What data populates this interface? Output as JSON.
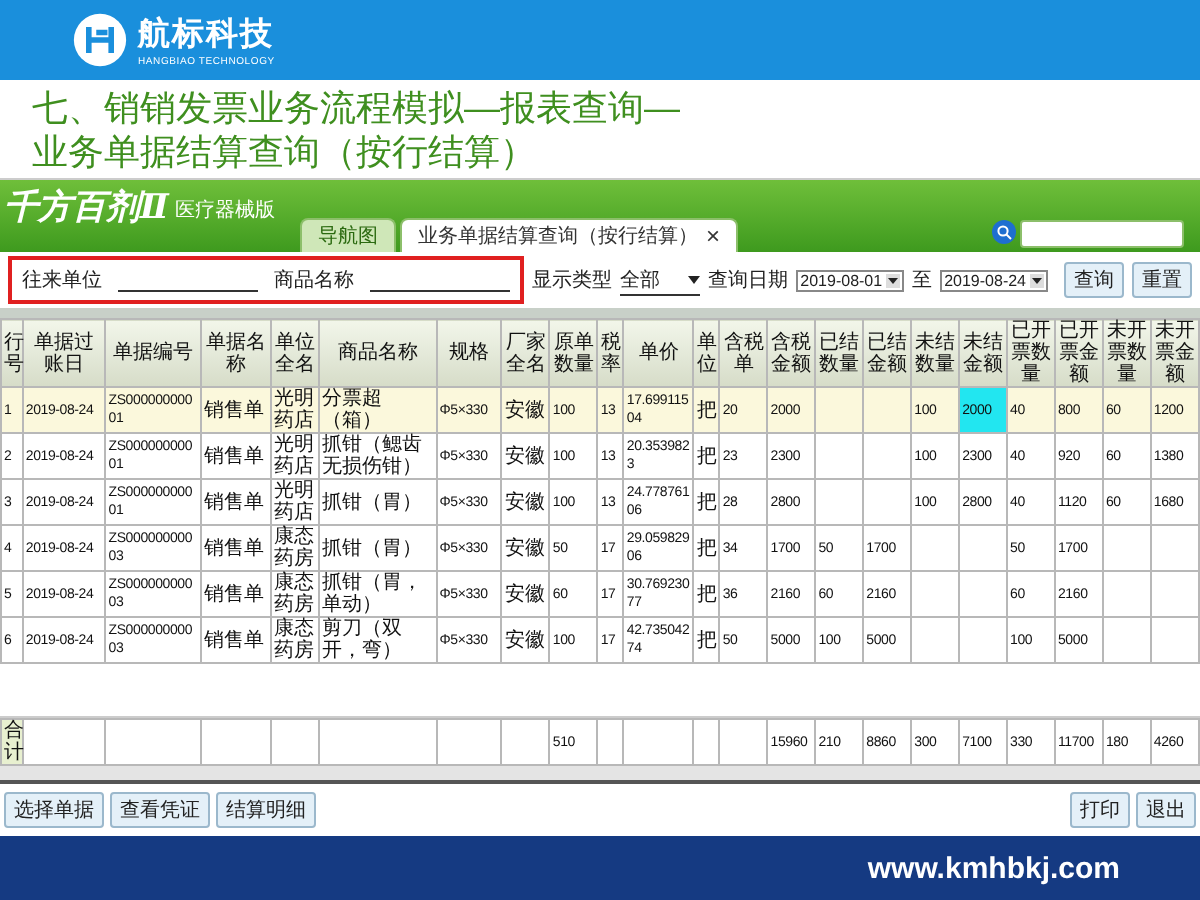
{
  "slide_header": {
    "logo_text": "航标科技",
    "logo_subtitle": "HANGBIAO TECHNOLOGY"
  },
  "title_lines": [
    "七、销销发票业务流程模拟—报表查询—",
    "业务单据结算查询（按行结算）"
  ],
  "app": {
    "brand": "千方百剂Ⅱ",
    "edition": "医疗器械版",
    "tabs": [
      {
        "label": "导航图",
        "selected": false,
        "closable": false
      },
      {
        "label": "业务单据结算查询（按行结算）",
        "selected": true,
        "closable": true
      }
    ],
    "close_glyph": "×",
    "filters": {
      "partner_label": "往来单位",
      "product_label": "商品名称",
      "display_type_label": "显示类型",
      "display_type_value": "全部",
      "date_label": "查询日期",
      "date_from": "2019-08-01",
      "date_to_label": "至",
      "date_to": "2019-08-24",
      "query_button": "查询",
      "reset_button": "重置"
    },
    "table": {
      "columns": [
        "行号",
        "单据过账日",
        "单据编号",
        "单据名称",
        "单位全名",
        "商品名称",
        "规格",
        "厂家全名",
        "原单数量",
        "税率",
        "单价",
        "单位",
        "含税单",
        "含税金额",
        "已结数量",
        "已结金额",
        "未结数量",
        "未结金额",
        "已开票数量",
        "已开票金额",
        "未开票数量",
        "未开票金额"
      ],
      "rows": [
        {
          "selected": true,
          "no": "1",
          "date": "2019-08-24",
          "doc_no": "ZS00000000001",
          "doc_name": "销售单",
          "unit_name": "光明药店",
          "product": "分票超（箱）",
          "spec": "Φ5×330",
          "maker": "安徽",
          "orig_qty": "100",
          "tax_rate": "13",
          "price": "17.69911504",
          "uom": "把",
          "price_incl_tax": "20",
          "amount_incl_tax": "2000",
          "unsettled_qty": "100",
          "unsettled_amt": {
            "text": "2000",
            "selected": true
          },
          "invoiced_qty": "40",
          "invoiced_amt": "800",
          "uninvoiced_qty": "60",
          "uninvoiced_amt": "1200"
        },
        {
          "selected": false,
          "no": "2",
          "date": "2019-08-24",
          "doc_no": "ZS00000000001",
          "doc_name": "销售单",
          "unit_name": "光明药店",
          "product": "抓钳（鳃齿无损伤钳）",
          "spec": "Φ5×330",
          "maker": "安徽",
          "orig_qty": "100",
          "tax_rate": "13",
          "price": "20.3539823",
          "uom": "把",
          "price_incl_tax": "23",
          "amount_incl_tax": "2300",
          "unsettled_qty": "100",
          "unsettled_amt": {
            "text": "2300",
            "selected": false
          },
          "invoiced_qty": "40",
          "invoiced_amt": "920",
          "uninvoiced_qty": "60",
          "uninvoiced_amt": "1380"
        },
        {
          "selected": false,
          "no": "3",
          "date": "2019-08-24",
          "doc_no": "ZS00000000001",
          "doc_name": "销售单",
          "unit_name": "光明药店",
          "product": "抓钳（胃）",
          "spec": "Φ5×330",
          "maker": "安徽",
          "orig_qty": "100",
          "tax_rate": "13",
          "price": "24.77876106",
          "uom": "把",
          "price_incl_tax": "28",
          "amount_incl_tax": "2800",
          "unsettled_qty": "100",
          "unsettled_amt": {
            "text": "2800",
            "selected": false
          },
          "invoiced_qty": "40",
          "invoiced_amt": "1120",
          "uninvoiced_qty": "60",
          "uninvoiced_amt": "1680"
        },
        {
          "selected": false,
          "no": "4",
          "date": "2019-08-24",
          "doc_no": "ZS00000000003",
          "doc_name": "销售单",
          "unit_name": "康态药房",
          "product": "抓钳（胃）",
          "spec": "Φ5×330",
          "maker": "安徽",
          "orig_qty": "50",
          "tax_rate": "17",
          "price": "29.05982906",
          "uom": "把",
          "price_incl_tax": "34",
          "amount_incl_tax": "1700",
          "settled_qty": "50",
          "settled_amt": "1700",
          "invoiced_qty": "50",
          "invoiced_amt": "1700"
        },
        {
          "selected": false,
          "no": "5",
          "date": "2019-08-24",
          "doc_no": "ZS00000000003",
          "doc_name": "销售单",
          "unit_name": "康态药房",
          "product": "抓钳（胃，单动）",
          "spec": "Φ5×330",
          "maker": "安徽",
          "orig_qty": "60",
          "tax_rate": "17",
          "price": "30.76923077",
          "uom": "把",
          "price_incl_tax": "36",
          "amount_incl_tax": "2160",
          "settled_qty": "60",
          "settled_amt": "2160",
          "invoiced_qty": "60",
          "invoiced_amt": "2160"
        },
        {
          "selected": false,
          "no": "6",
          "date": "2019-08-24",
          "doc_no": "ZS00000000003",
          "doc_name": "销售单",
          "unit_name": "康态药房",
          "product": "剪刀（双开，弯）",
          "spec": "Φ5×330",
          "maker": "安徽",
          "orig_qty": "100",
          "tax_rate": "17",
          "price": "42.73504274",
          "uom": "把",
          "price_incl_tax": "50",
          "amount_incl_tax": "5000",
          "settled_qty": "100",
          "settled_amt": "5000",
          "invoiced_qty": "100",
          "invoiced_amt": "5000"
        }
      ],
      "totals": {
        "no": "合计",
        "orig_qty": "510",
        "amount_incl_tax": "15960",
        "settled_qty": "210",
        "settled_amt": "8860",
        "unsettled_qty": "300",
        "unsettled_amt": "7100",
        "invoiced_qty": "330",
        "invoiced_amt": "11700",
        "uninvoiced_qty": "180",
        "uninvoiced_amt": "4260"
      }
    },
    "buttons_left": [
      "选择单据",
      "查看凭证",
      "结算明细"
    ],
    "buttons_right": [
      "打印",
      "退出"
    ]
  },
  "footer": {
    "url": "www.kmhbkj.com"
  }
}
